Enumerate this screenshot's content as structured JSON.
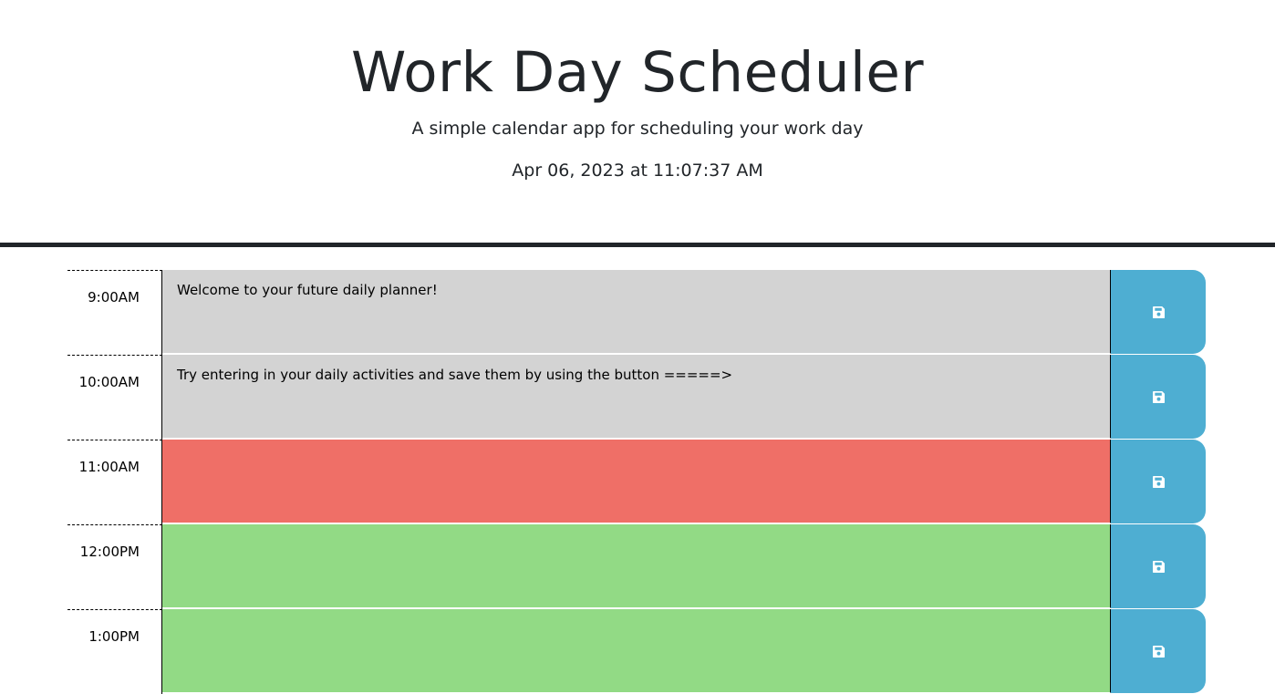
{
  "header": {
    "title": "Work Day Scheduler",
    "lead": "A simple calendar app for scheduling your work day",
    "current_datetime": "Apr 06, 2023 at 11:07:37 AM"
  },
  "colors": {
    "past": "#d3d3d3",
    "present": "#ef6f67",
    "future": "#92da85",
    "save_button": "#4eaed2"
  },
  "save_icon": "floppy-disk-icon",
  "hours": [
    {
      "label": "9:00AM",
      "text": "Welcome to your future daily planner!",
      "state": "past"
    },
    {
      "label": "10:00AM",
      "text": "Try entering in your daily activities and save them by using the button =====>",
      "state": "past"
    },
    {
      "label": "11:00AM",
      "text": "",
      "state": "present"
    },
    {
      "label": "12:00PM",
      "text": "",
      "state": "future"
    },
    {
      "label": "1:00PM",
      "text": "",
      "state": "future"
    }
  ]
}
